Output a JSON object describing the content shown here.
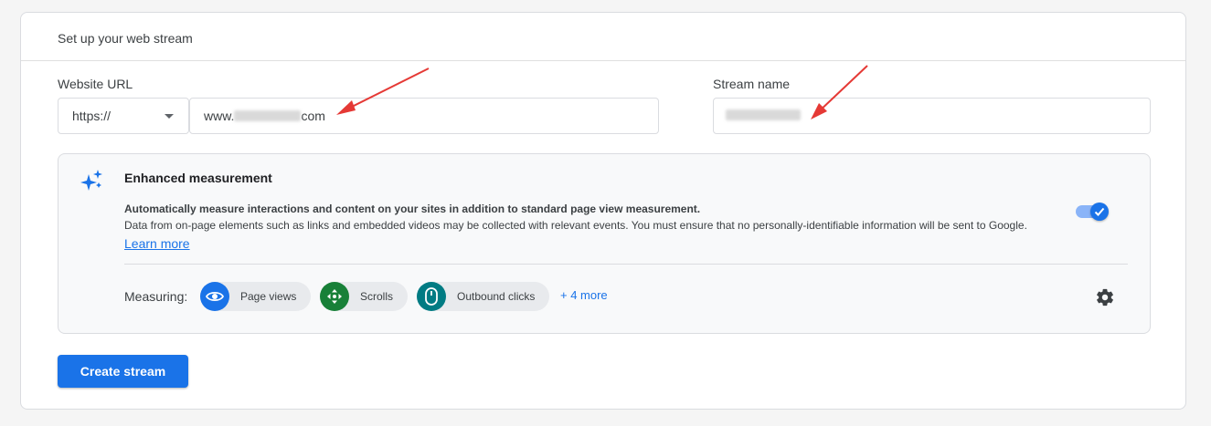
{
  "card": {
    "title": "Set up your web stream"
  },
  "url_field": {
    "label": "Website URL",
    "protocol": "https://",
    "value_prefix": "www.",
    "value_suffix": "com"
  },
  "stream_field": {
    "label": "Stream name"
  },
  "enhanced": {
    "title": "Enhanced measurement",
    "desc_bold": "Automatically measure interactions and content on your sites in addition to standard page view measurement.",
    "desc": "Data from on-page elements such as links and embedded videos may be collected with relevant events. You must ensure that no personally-identifiable information will be sent to Google.",
    "learn_more": "Learn more",
    "toggle_on": true,
    "measuring_label": "Measuring:",
    "chips": [
      {
        "label": "Page views",
        "icon": "eye-icon",
        "color": "#1a73e8"
      },
      {
        "label": "Scrolls",
        "icon": "scroll-icon",
        "color": "#188038"
      },
      {
        "label": "Outbound clicks",
        "icon": "mouse-icon",
        "color": "#007b83"
      }
    ],
    "more": "+ 4 more"
  },
  "create_button": "Create stream",
  "colors": {
    "accent": "#1a73e8",
    "annotation_arrow": "#e53935"
  }
}
